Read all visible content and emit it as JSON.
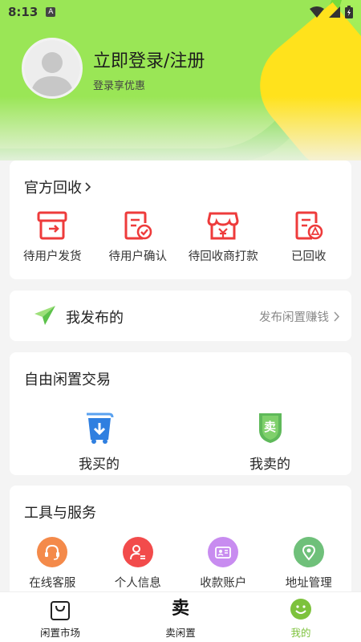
{
  "status": {
    "time": "8:13",
    "a_badge": "A"
  },
  "header": {
    "login_title": "立即登录/注册",
    "login_sub": "登录享优惠"
  },
  "recycle": {
    "title": "官方回收",
    "items": [
      {
        "label": "待用户发货",
        "icon": "box-icon"
      },
      {
        "label": "待用户确认",
        "icon": "document-check-icon"
      },
      {
        "label": "待回收商打款",
        "icon": "shop-icon"
      },
      {
        "label": "已回收",
        "icon": "recycle-document-icon"
      }
    ]
  },
  "publish": {
    "label": "我发布的",
    "right": "发布闲置赚钱"
  },
  "trade": {
    "title": "自由闲置交易",
    "bought": "我买的",
    "sold": "我卖的",
    "sold_badge": "卖"
  },
  "tools": {
    "title": "工具与服务",
    "items": [
      {
        "label": "在线客服",
        "icon": "headset-icon",
        "color": "#f48a4a"
      },
      {
        "label": "个人信息",
        "icon": "person-icon",
        "color": "#f24b4b"
      },
      {
        "label": "收款账户",
        "icon": "card-icon",
        "color": "#c88cf0"
      },
      {
        "label": "地址管理",
        "icon": "location-icon",
        "color": "#6fc07a"
      }
    ]
  },
  "tabbar": {
    "market": "闲置市场",
    "sell": "卖闲置",
    "sell_glyph": "卖",
    "mine": "我的"
  },
  "colors": {
    "accent_green": "#7dc23c",
    "icon_red": "#ee3b3b",
    "brand_blue": "#2f7fe0",
    "yellow": "#ffe21c"
  }
}
